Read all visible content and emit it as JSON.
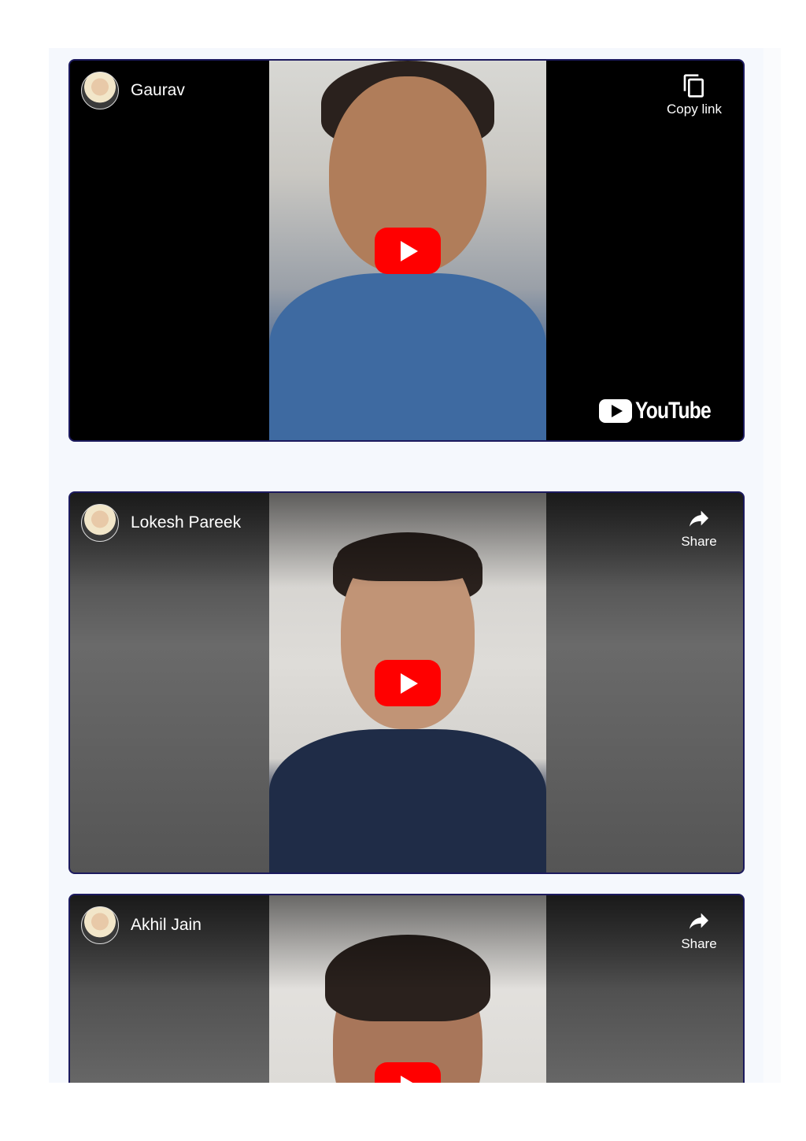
{
  "videos": [
    {
      "title": "Gaurav",
      "action": {
        "label": "Copy link",
        "icon": "copy-icon"
      },
      "show_logo": true,
      "logo_text": "YouTube"
    },
    {
      "title": "Lokesh Pareek",
      "action": {
        "label": "Share",
        "icon": "share-icon"
      }
    },
    {
      "title": "Akhil Jain",
      "action": {
        "label": "Share",
        "icon": "share-icon"
      }
    }
  ],
  "colors": {
    "play_button": "#ff0000",
    "card_border": "#1c1a5e",
    "panel_bg": "#f5f8fd"
  }
}
